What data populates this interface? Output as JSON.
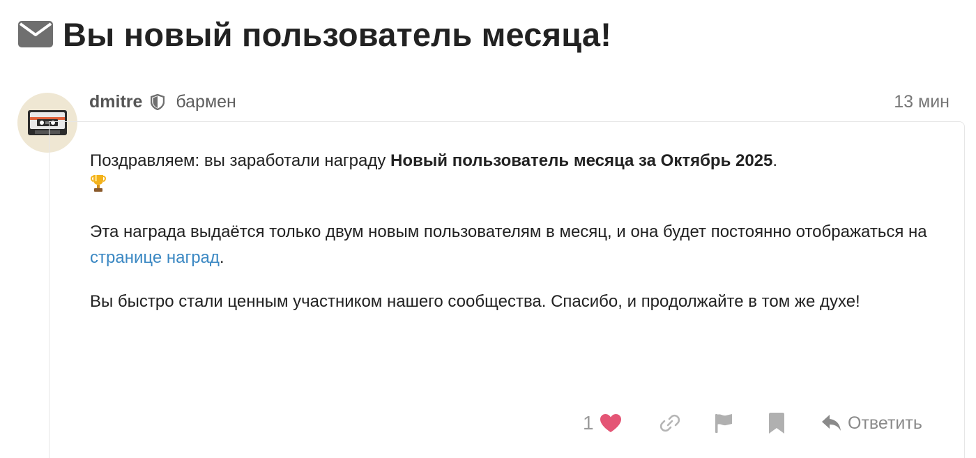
{
  "topic": {
    "title": "Вы новый пользователь месяца!",
    "title_icon": "envelope-icon"
  },
  "post": {
    "username": "dmitre",
    "moderator_icon": "shield-icon",
    "user_title": "бармен",
    "time": "13 мин",
    "avatar_icon": "cassette-tape-icon",
    "paragraph1_prefix": "Поздравляем: вы заработали награду ",
    "paragraph1_badge": "Новый пользователь месяца за Октябрь 2025",
    "paragraph1_suffix": ".",
    "trophy_icon": "trophy-icon",
    "paragraph2_prefix": "Эта награда выдаётся только двум новым пользователям в месяц, и она будет постоянно отображаться на ",
    "paragraph2_link": "странице наград",
    "paragraph2_suffix": ".",
    "paragraph3": "Вы быстро стали ценным участником нашего сообщества. Спасибо, и продолжайте в том же духе!"
  },
  "actions": {
    "like_count": "1",
    "like_icon": "heart-icon",
    "link_icon": "link-icon",
    "flag_icon": "flag-icon",
    "bookmark_icon": "bookmark-icon",
    "reply_icon": "reply-icon",
    "reply_label": "Ответить"
  },
  "colors": {
    "heart": "#e45575",
    "link": "#3b88c3",
    "avatar_bg": "#efe7d3",
    "icon_gray": "#9a9a9a"
  }
}
